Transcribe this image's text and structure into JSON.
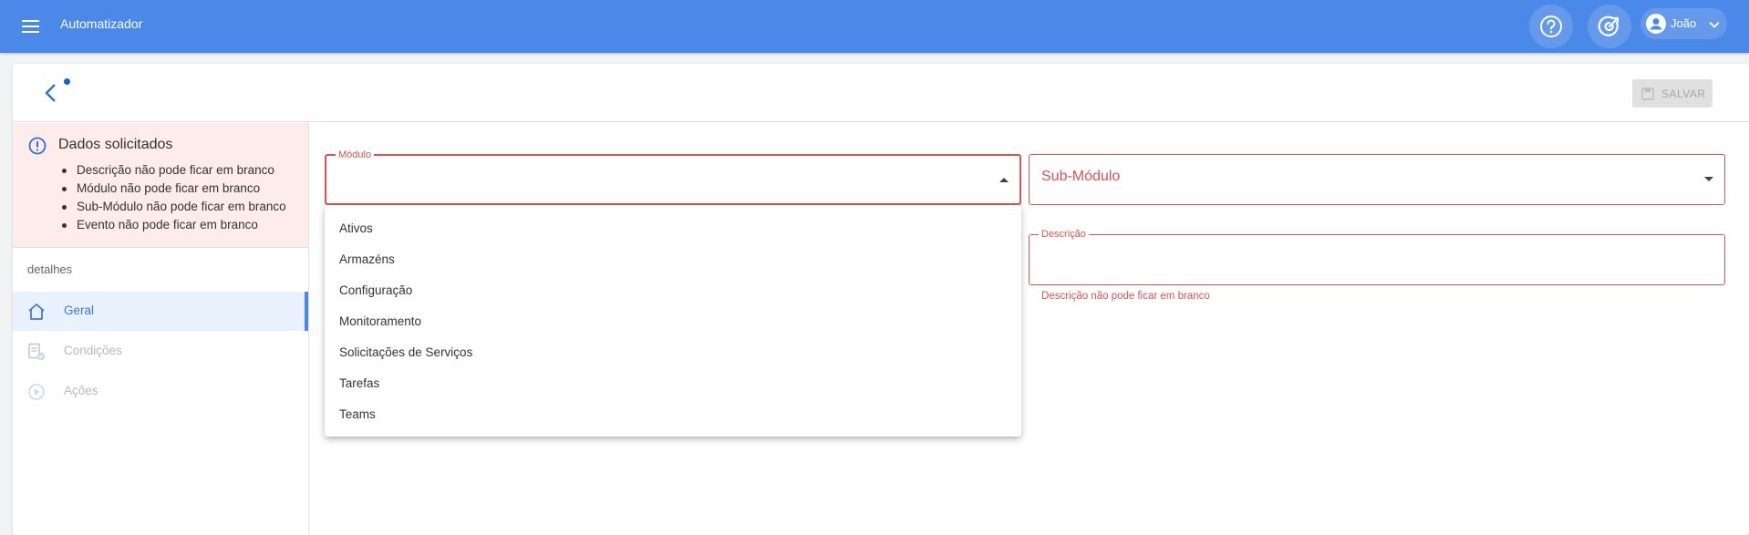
{
  "topbar": {
    "app_title": "Automatizador",
    "user_name": "João",
    "icons": {
      "menu": "menu-icon",
      "help": "help-circle-icon",
      "target": "target-icon",
      "user": "account-icon",
      "chevron": "chevron-down-icon"
    }
  },
  "toolbar": {
    "save_label": "SALVAR"
  },
  "errors": {
    "title": "Dados solicitados",
    "items": [
      "Descrição não pode ficar em branco",
      "Módulo não pode ficar em branco",
      "Sub-Módulo não pode ficar em branco",
      "Evento não pode ficar em branco"
    ]
  },
  "sidebar": {
    "section_label": "detalhes",
    "items": [
      {
        "label": "Geral",
        "icon": "home-icon",
        "active": true
      },
      {
        "label": "Condições",
        "icon": "conditions-icon",
        "active": false
      },
      {
        "label": "Ações",
        "icon": "play-circle-icon",
        "active": false
      }
    ]
  },
  "form": {
    "modulo": {
      "label": "Módulo",
      "value": ""
    },
    "sub_modulo": {
      "label": "Sub-Módulo",
      "value": ""
    },
    "descricao": {
      "label": "Descrição",
      "value": "",
      "error": "Descrição não pode ficar em branco"
    }
  },
  "dropdown": {
    "options": [
      "Ativos",
      "Armazéns",
      "Configuração",
      "Monitoramento",
      "Solicitações de Serviços",
      "Tarefas",
      "Teams"
    ]
  },
  "colors": {
    "topbar": "#4a89e8",
    "error": "#d9534f",
    "error_bg": "#fdecea",
    "active_nav_bg": "#e9f1fd"
  }
}
